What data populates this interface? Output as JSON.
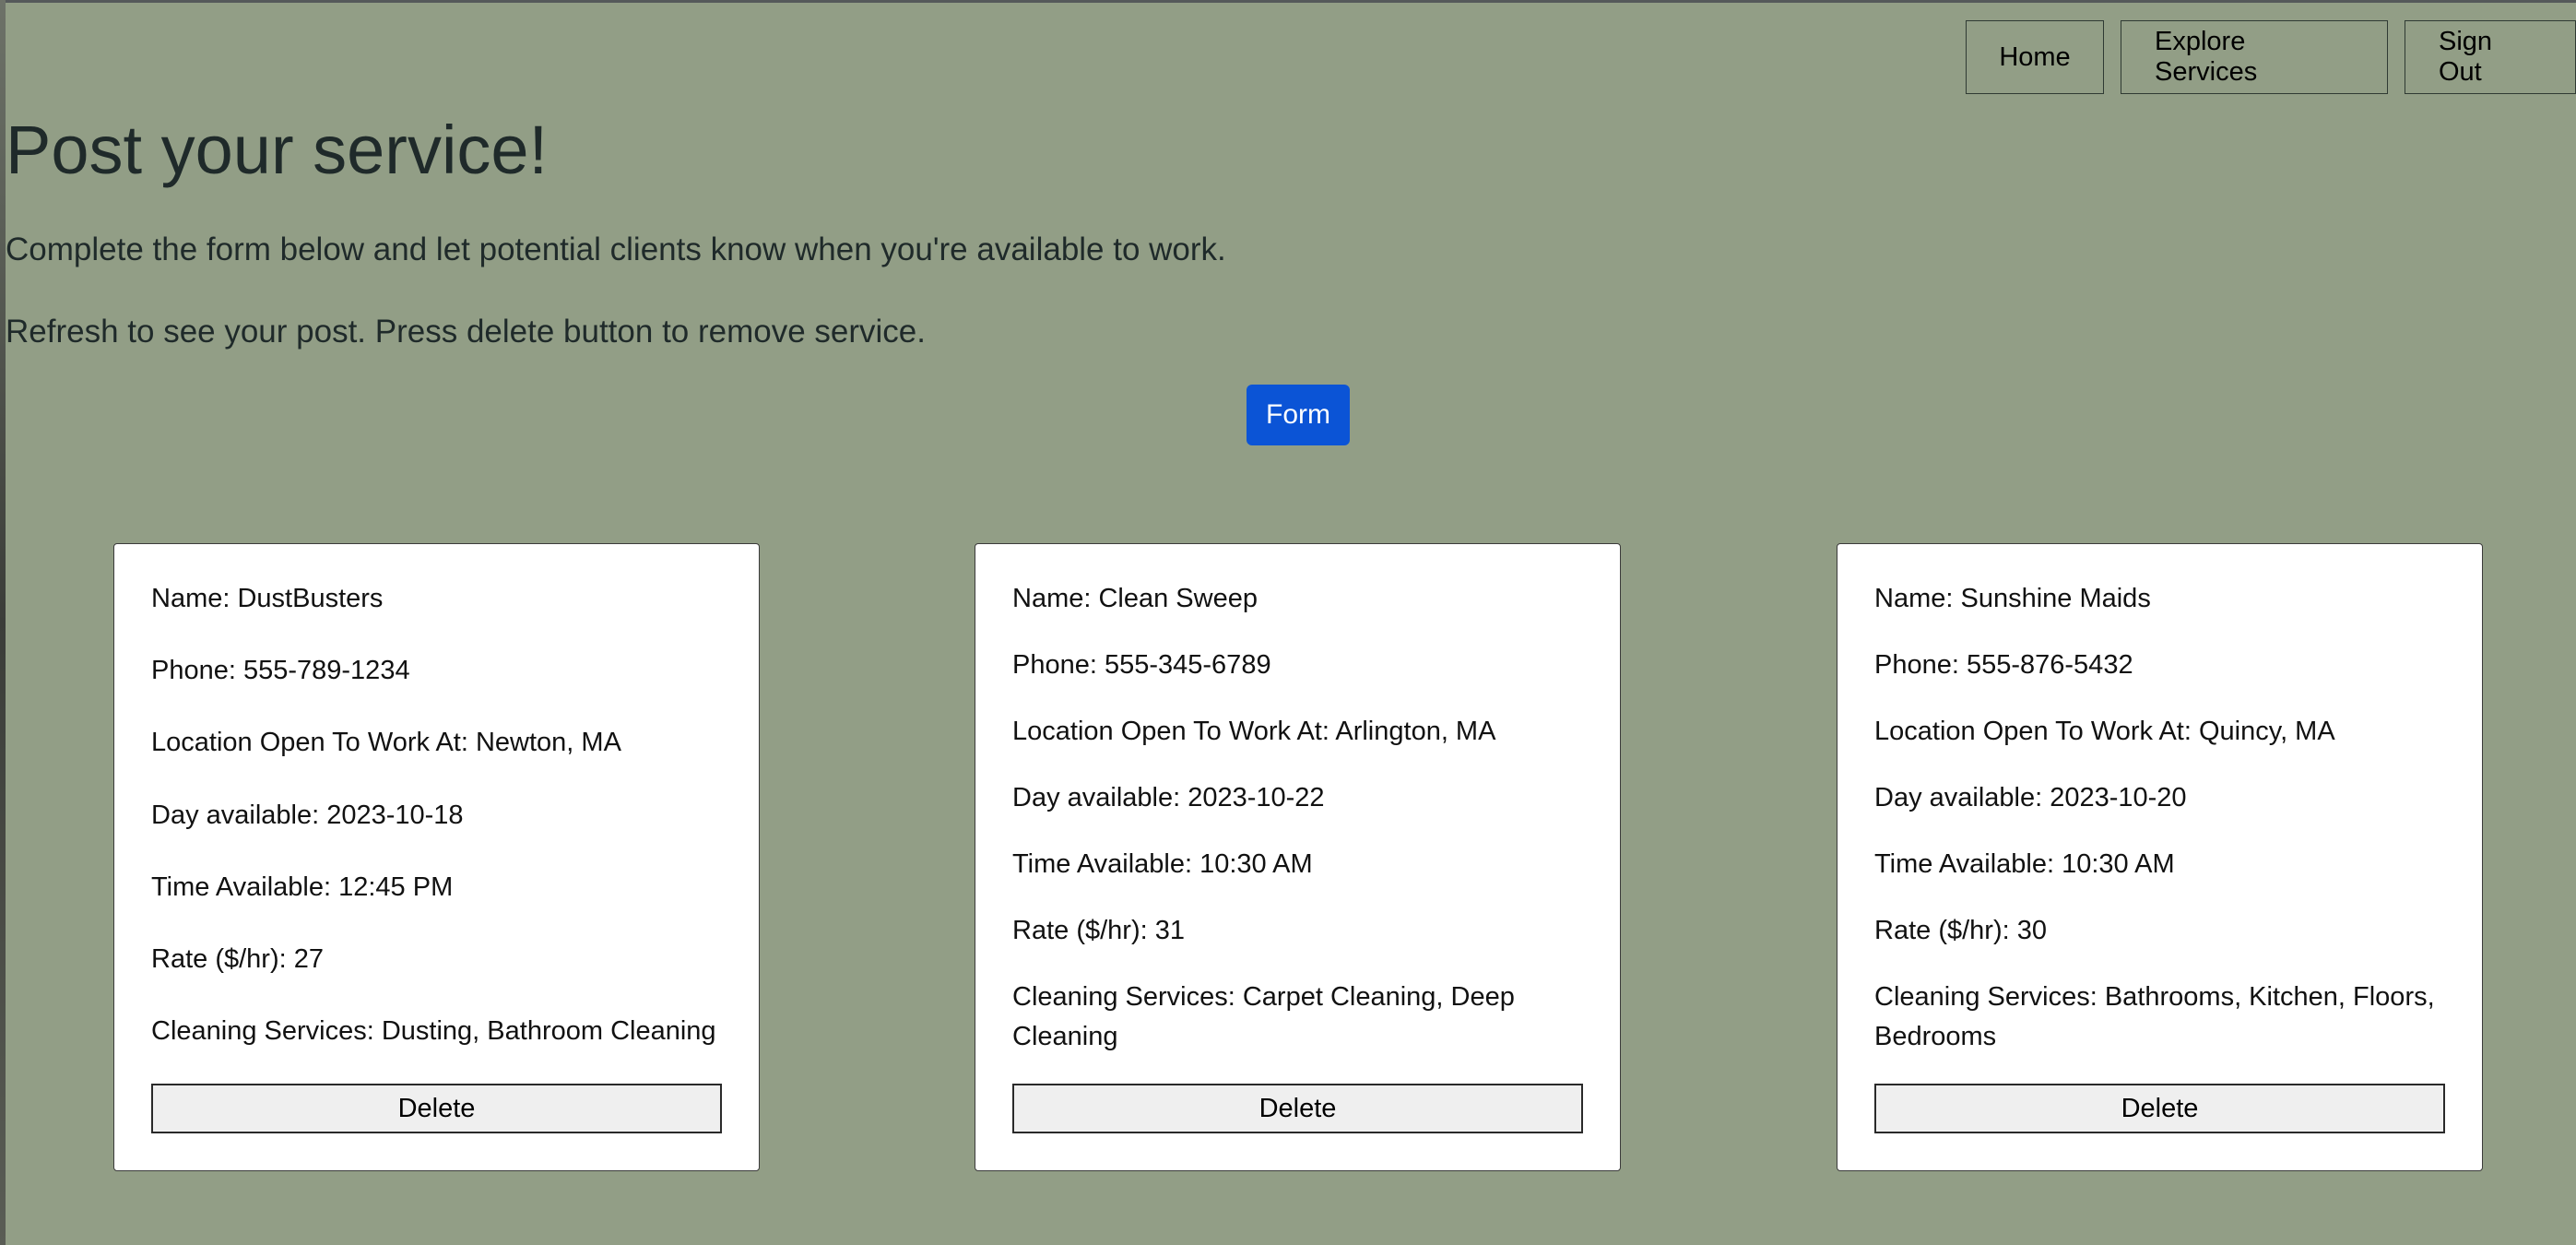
{
  "nav": {
    "home": "Home",
    "explore": "Explore Services",
    "signout": "Sign Out"
  },
  "page": {
    "title": "Post your service!",
    "intro1": "Complete the form below and let potential clients know when you're available to work.",
    "intro2": "Refresh to see your post. Press delete button to remove service.",
    "form_button": "Form"
  },
  "cards": [
    {
      "name": "Name: DustBusters",
      "phone": "Phone: 555-789-1234",
      "location": "Location Open To Work At: Newton, MA",
      "day": "Day available: 2023-10-18",
      "time": "Time Available: 12:45 PM",
      "rate": "Rate ($/hr): 27",
      "services": "Cleaning Services: Dusting, Bathroom Cleaning",
      "delete": "Delete"
    },
    {
      "name": "Name: Clean Sweep",
      "phone": "Phone: 555-345-6789",
      "location": "Location Open To Work At: Arlington, MA",
      "day": "Day available: 2023-10-22",
      "time": "Time Available: 10:30 AM",
      "rate": "Rate ($/hr): 31",
      "services": "Cleaning Services: Carpet Cleaning, Deep Cleaning",
      "delete": "Delete"
    },
    {
      "name": "Name: Sunshine Maids",
      "phone": "Phone: 555-876-5432",
      "location": "Location Open To Work At: Quincy, MA",
      "day": "Day available: 2023-10-20",
      "time": "Time Available: 10:30 AM",
      "rate": "Rate ($/hr): 30",
      "services": "Cleaning Services: Bathrooms, Kitchen, Floors, Bedrooms",
      "delete": "Delete"
    }
  ],
  "colors": {
    "background": "#929e86",
    "accent": "#0b54d6",
    "card": "#ffffff"
  }
}
